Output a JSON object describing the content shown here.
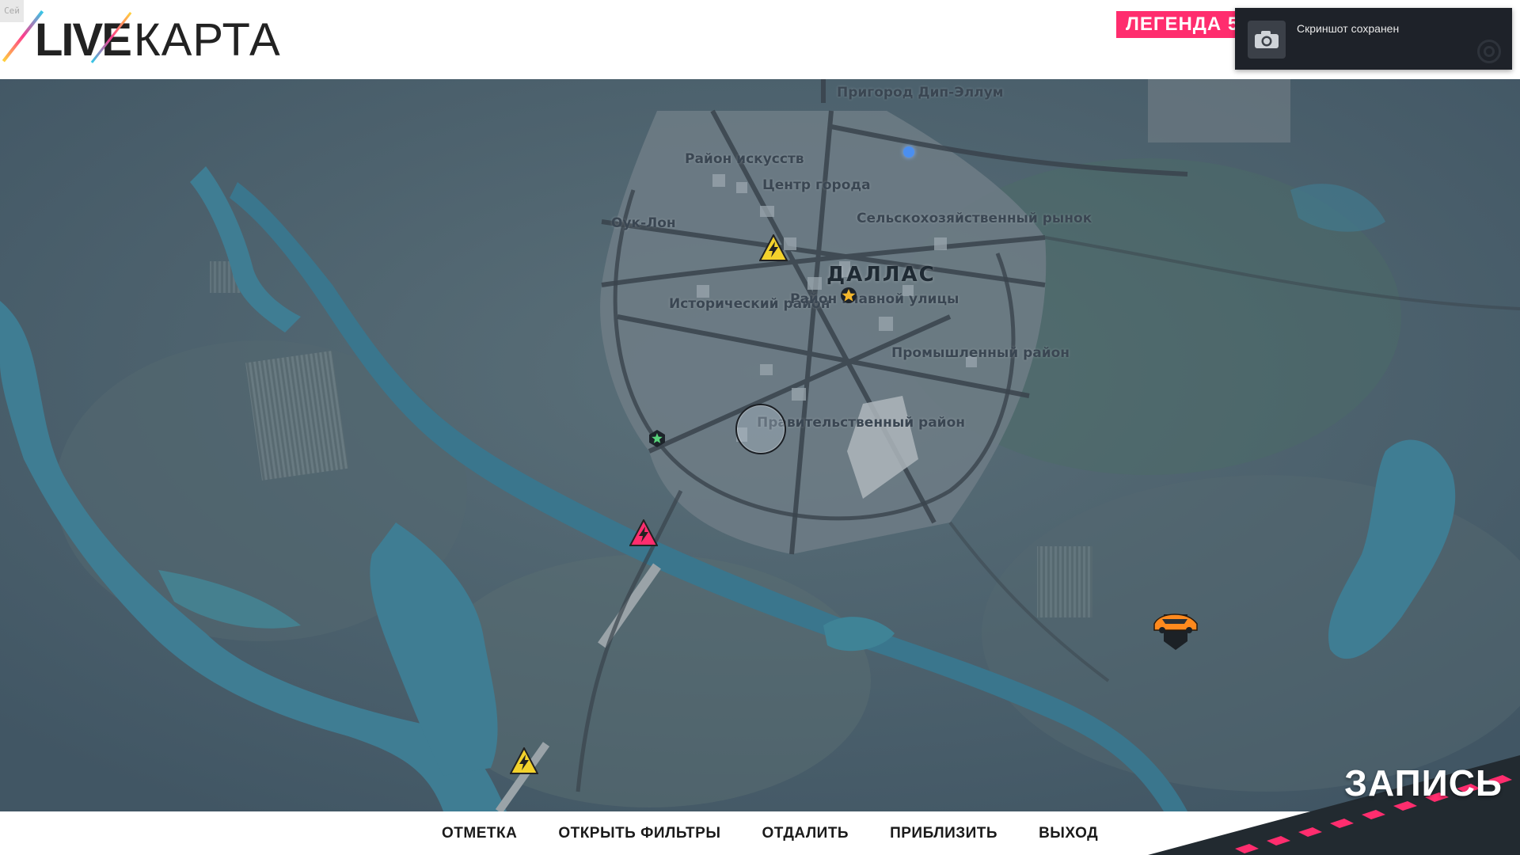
{
  "header": {
    "fps": "Сей",
    "logo_live": "LIVE",
    "logo_map": "КАРТА",
    "legend_badge": "ЛЕГЕНДА 56"
  },
  "toast": {
    "text": "Скриншот сохранен",
    "icon": "camera-icon"
  },
  "map": {
    "city": "ДАЛЛАС",
    "districts": [
      "Пригород Дип-Эллум",
      "Район искусств",
      "Центр города",
      "Оук-Лон",
      "Сельскохозяйственный рынок",
      "Исторический район",
      "Район главной улицы",
      "Промышленный район",
      "Правительственный район"
    ],
    "markers": [
      {
        "type": "event-bolt-yellow",
        "icon": "lightning-icon"
      },
      {
        "type": "event-bolt-pink",
        "icon": "lightning-icon"
      },
      {
        "type": "event-bolt-yellow",
        "icon": "lightning-icon"
      },
      {
        "type": "star-marker",
        "icon": "star-icon"
      },
      {
        "type": "green-star-marker",
        "icon": "star-icon"
      },
      {
        "type": "player-car",
        "icon": "car-icon"
      }
    ],
    "colors": {
      "water": "#3f7d93",
      "land": "#4d6470",
      "city": "#6f7c86",
      "accent": "#ff2d6e"
    }
  },
  "actions": [
    "ОТМЕТКА",
    "ОТКРЫТЬ ФИЛЬТРЫ",
    "ОТДАЛИТЬ",
    "ПРИБЛИЗИТЬ",
    "ВЫХОД"
  ],
  "record": {
    "label": "ЗАПИСЬ"
  }
}
